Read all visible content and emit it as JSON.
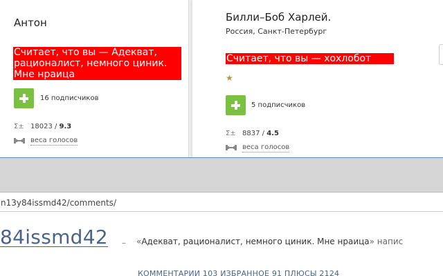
{
  "cards": [
    {
      "name": "Антон",
      "location": "",
      "verdict_lines": [
        "Считает, что вы — Адекват,",
        "рационалист, немного циник.",
        "Мне нраица"
      ],
      "subscribers": "16 подписчиков",
      "stats_icon": "sigma-plusminus-icon",
      "stats_value": "18023",
      "stats_sep": " / ",
      "stats_rating": "9.3",
      "weights_link": "веса голосов"
    },
    {
      "name": "Билли–Боб Харлей.",
      "location": "Россия, Санкт-Петербург",
      "verdict_lines": [
        "Считает, что вы — хохлобот"
      ],
      "stars": 1,
      "subscribers": "5 подписчиков",
      "stats_icon": "sigma-plusminus-icon",
      "stats_value": "8837",
      "stats_sep": " / ",
      "stats_rating": "4.5",
      "weights_link": "веса голосов"
    }
  ],
  "browser": {
    "address": "n13y84issmd42/comments/"
  },
  "page": {
    "username": "84issmd42",
    "dash": "–",
    "quote_open": "«",
    "quote_text": "Адекват, рационалист, немного циник. Мне нраица",
    "quote_close": "»",
    "quote_tail": " напис",
    "counts": "КОММЕНТАРИИ 103   ИЗБРАННОЕ 91   ПЛЮСЫ 2124"
  },
  "colors": {
    "verdict_bg": "#ff0000",
    "plus_button": "#7ac142",
    "link_blue": "#4a6488",
    "star": "#b8944a"
  }
}
